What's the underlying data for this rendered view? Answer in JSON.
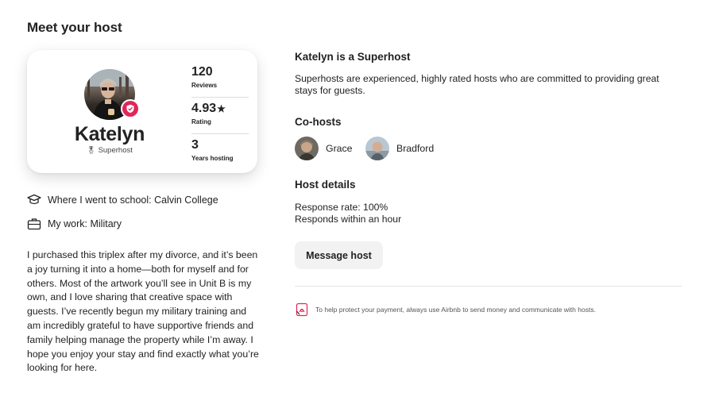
{
  "section_title": "Meet your host",
  "host": {
    "name": "Katelyn",
    "role": "Superhost",
    "avatar_icon": "host-avatar-photo",
    "badge_icon": "verified-shield-icon",
    "stats": [
      {
        "value": "120",
        "label": "Reviews",
        "suffix": ""
      },
      {
        "value": "4.93",
        "label": "Rating",
        "suffix": "★"
      },
      {
        "value": "3",
        "label": "Years hosting",
        "suffix": ""
      }
    ]
  },
  "facts": [
    {
      "icon": "graduation-cap-icon",
      "text": "Where I went to school: Calvin College"
    },
    {
      "icon": "briefcase-icon",
      "text": "My work: Military"
    }
  ],
  "bio": "I purchased this triplex after my divorce, and it’s been a joy turning it into a home—both for myself and for others. Most of the artwork you’ll see in Unit B is my own, and I love sharing that creative space with guests. I’ve recently begun my military training and am incredibly grateful to have supportive friends and family helping manage the property while I’m away. I hope you enjoy your stay and find exactly what you’re looking for here.",
  "superhost": {
    "title": "Katelyn is a Superhost",
    "description": "Superhosts are experienced, highly rated hosts who are committed to providing great stays for guests."
  },
  "cohosts": {
    "title": "Co-hosts",
    "items": [
      {
        "name": "Grace"
      },
      {
        "name": "Bradford"
      }
    ]
  },
  "details": {
    "title": "Host details",
    "response_rate": "Response rate: 100%",
    "response_time": "Responds within an hour"
  },
  "message_button": "Message host",
  "protect_notice": "To help protect your payment, always use Airbnb to send money and communicate with hosts.",
  "colors": {
    "badge": "#e0265a",
    "button_bg": "#f2f2f2",
    "text": "#222222"
  }
}
